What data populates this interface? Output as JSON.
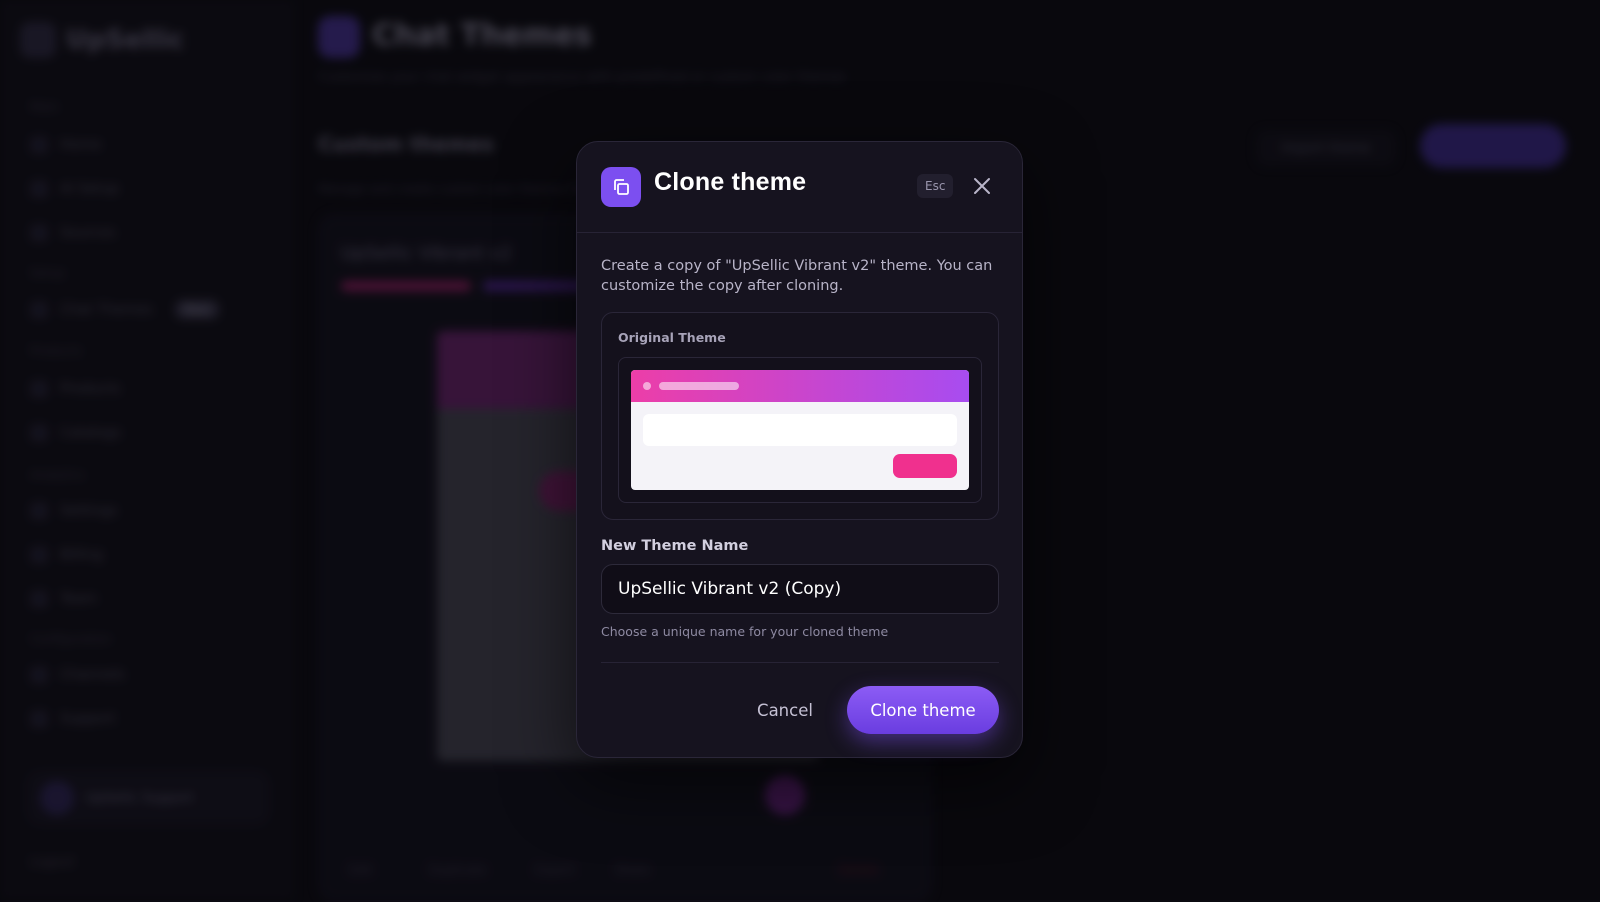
{
  "app": {
    "brand": "UpSellic",
    "page_title": "Chat Themes",
    "page_subtitle": "Customize your chat widget appearance with predefined or custom color themes",
    "section_title": "Custom themes",
    "section_subtitle": "Manage and create custom color themes for your chat widget",
    "import_label": "Import theme",
    "theme_card_name": "UpSellic Vibrant v2",
    "sidebar": {
      "sections": [
        "Main",
        "Setup",
        "Products",
        "Analytics",
        "Configuration"
      ],
      "items": [
        "Home",
        "AI Setup",
        "Sources",
        "Chat Themes",
        "Products",
        "Catalogs",
        "Settings",
        "Billing",
        "Team",
        "Channels",
        "Support"
      ],
      "badge": "New",
      "user_name": "UpSellic Support",
      "logout": "Logout"
    },
    "card_footer": [
      "Edit",
      "Duplicate",
      "Export",
      "Share",
      "Delete"
    ]
  },
  "modal": {
    "title": "Clone theme",
    "esc_label": "Esc",
    "description": "Create a copy of \"UpSellic Vibrant v2\" theme. You can customize the copy after cloning.",
    "original_theme_label": "Original Theme",
    "field_label": "New Theme Name",
    "field_value": "UpSellic Vibrant v2 (Copy)",
    "field_hint": "Choose a unique name for your cloned theme",
    "cancel_label": "Cancel",
    "confirm_label": "Clone theme"
  },
  "icons": {
    "header": "copy-icon",
    "close": "close-icon"
  },
  "colors": {
    "accent": "#7c4ff0",
    "preview_gradient_start": "#ec3ea8",
    "preview_gradient_end": "#a84cf0",
    "preview_button": "#f0308e"
  }
}
